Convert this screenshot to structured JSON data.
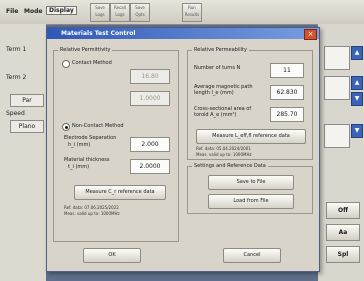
{
  "menubar": {
    "items": [
      "File",
      "Mode",
      "Display"
    ],
    "toolbar_buttons": [
      "Save Logs",
      "Recall Logs",
      "Save Opts",
      "Run Results"
    ]
  },
  "background_app": {
    "labels": [
      "Term 1",
      "Term 2",
      "Speed"
    ],
    "fields": [
      "Par",
      "Plano"
    ]
  },
  "right_panel": {
    "buttons": [
      "Off",
      "Aa",
      "Spl"
    ]
  },
  "dialog": {
    "title": "Materials Test Control",
    "close_glyph": "×",
    "left_group": {
      "title": "Relative Permittivity",
      "contact_method": {
        "label": "Contact Method",
        "field1_value": "16.80",
        "field2_value": "1.0000"
      },
      "noncontact_method": {
        "label": "Non-Contact Method",
        "electrode_sep_label": "Electrode Separation",
        "electrode_sep_unit": "h_i (mm)",
        "electrode_sep_value": "2.000",
        "material_thickness_label": "Material thickness",
        "material_thickness_unit": "t_i (mm)",
        "material_thickness_value": "2.0000",
        "measure_button": "Measure C_r reference data",
        "ref_note_line1": "Ref. data: 07.06.2025/2022",
        "ref_note_line2": "Meas. valid up to: 1000MHz"
      }
    },
    "right_group": {
      "title": "Relative Permeability",
      "turns_label": "Number of turns N",
      "turns_value": "11",
      "path_length_label": "Average magnetic path length l_e (mm)",
      "path_length_value": "62.830",
      "cross_section_label": "Cross-sectional area of toroid A_e (mm²)",
      "cross_section_value": "285.70",
      "measure_button": "Measure L_eff,fl reference data",
      "ref_note_line1": "Ref. data: 05.04.2024/2001",
      "ref_note_line2": "Meas. valid up to: 1000MHz"
    },
    "settings_group": {
      "title": "Settings and Reference Data",
      "save_button": "Save to File",
      "load_button": "Load from File"
    },
    "ok_button": "OK",
    "cancel_button": "Cancel"
  }
}
